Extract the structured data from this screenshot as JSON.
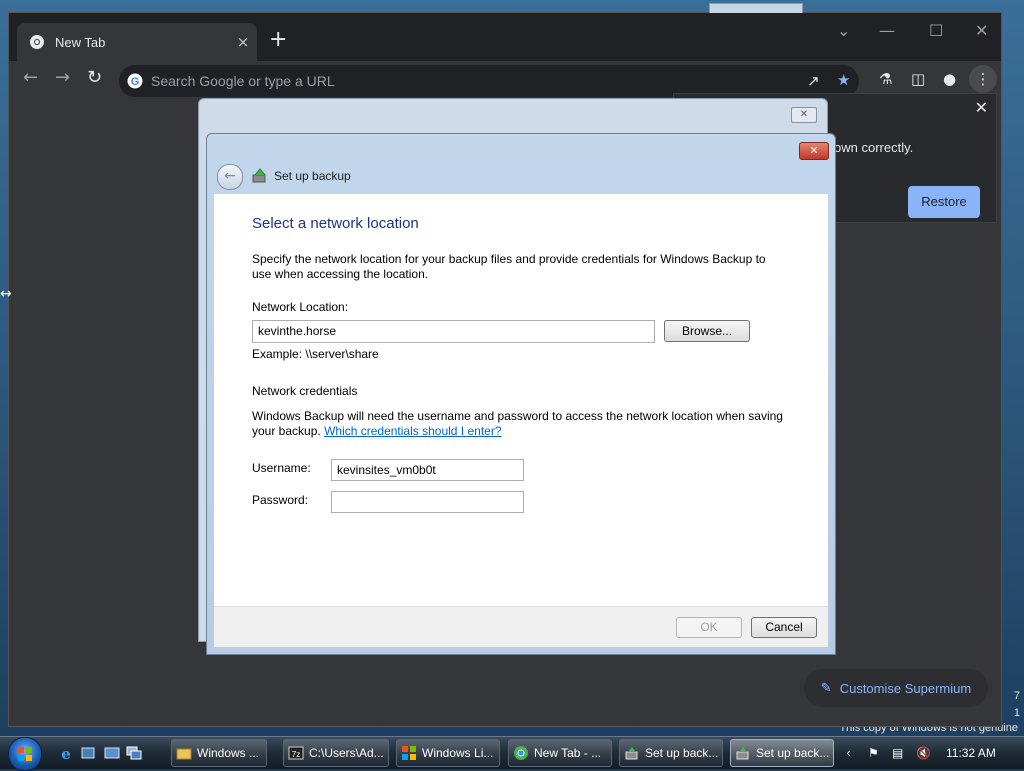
{
  "browser": {
    "tab_title": "New Tab",
    "tab_close": "×",
    "new_tab": "+",
    "omnibox_placeholder": "Search Google or type a URL",
    "restore_message": "own correctly.",
    "restore_button": "Restore",
    "customise_button": "Customise Supermium"
  },
  "dialog": {
    "title": "Set up backup",
    "heading": "Select a network location",
    "description": "Specify the network location for your backup files and provide credentials for Windows Backup to use when accessing the location.",
    "network_location_label": "Network Location:",
    "network_location_value": "kevinthe.horse",
    "browse_button": "Browse...",
    "example_text": "Example: \\\\server\\share",
    "credentials_heading": "Network credentials",
    "credentials_text": "Windows Backup will need the username and password to access the network location when saving your backup.",
    "credentials_link": "Which credentials should I enter?",
    "username_label": "Username:",
    "username_value": "kevinsites_vm0b0t",
    "password_label": "Password:",
    "password_value": "",
    "ok_button": "OK",
    "cancel_button": "Cancel"
  },
  "desktop": {
    "genuine_notice": "This copy of Windows is not genuine",
    "side_digit_1": "7",
    "side_digit_2": "1"
  },
  "taskbar": {
    "items": [
      {
        "label": "Windows ...",
        "icon": "folder-icon"
      },
      {
        "label": "C:\\Users\\Ad...",
        "icon": "7zip-icon"
      },
      {
        "label": "Windows Li...",
        "icon": "windows-live-icon"
      },
      {
        "label": "New Tab - ...",
        "icon": "chrome-icon"
      },
      {
        "label": "Set up back...",
        "icon": "backup-icon"
      },
      {
        "label": "Set up back...",
        "icon": "backup-icon"
      }
    ],
    "clock": "11:32 AM"
  },
  "colors": {
    "accent_blue": "#8ab4f8",
    "heading_blue": "#1e3287",
    "link_blue": "#0066cc"
  }
}
